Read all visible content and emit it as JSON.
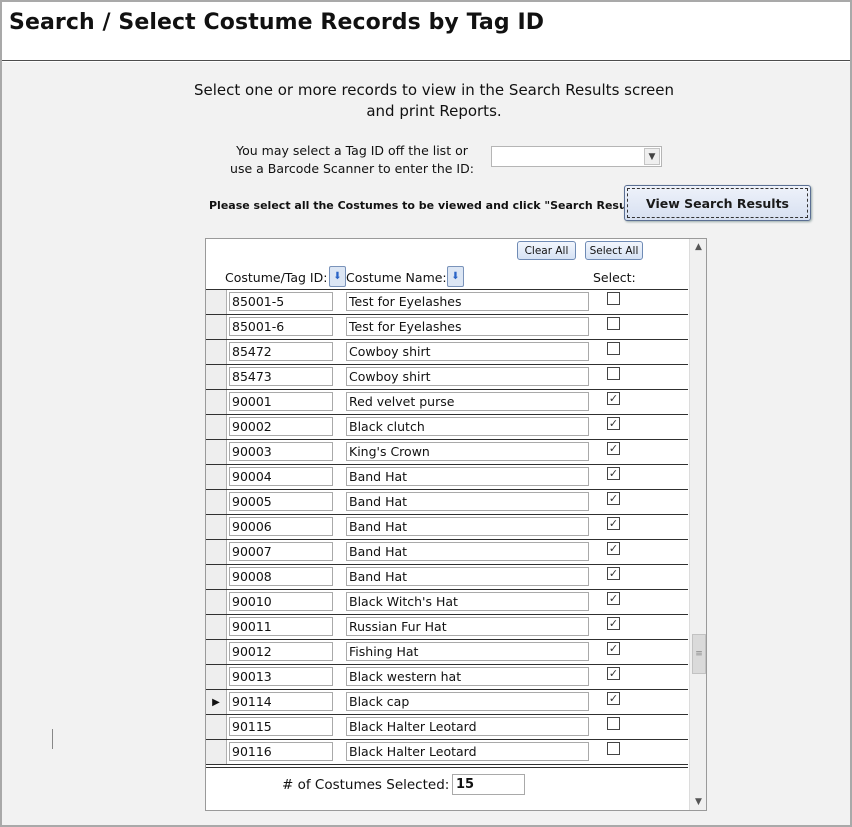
{
  "window": {
    "title": "Search / Select Costume Records by Tag ID"
  },
  "instructions": {
    "line1": "Select one or more records to view in the Search Results screen",
    "line2": "and print Reports."
  },
  "tag_select": {
    "label_line1": "You may select a Tag ID off the list or",
    "label_line2": "use a Barcode Scanner to enter the ID:",
    "value": ""
  },
  "prompt": "Please select all the Costumes to be viewed and click \"Search Results\"",
  "buttons": {
    "view_results": "View Search Results",
    "clear_all": "Clear All",
    "select_all": "Select All"
  },
  "table": {
    "columns": {
      "tag_id": "Costume/Tag ID:",
      "name": "Costume Name:",
      "select": "Select:"
    },
    "rows": [
      {
        "id": "85001-5",
        "name": "Test for Eyelashes",
        "selected": false,
        "current": false
      },
      {
        "id": "85001-6",
        "name": "Test for Eyelashes",
        "selected": false,
        "current": false
      },
      {
        "id": "85472",
        "name": "Cowboy shirt",
        "selected": false,
        "current": false
      },
      {
        "id": "85473",
        "name": "Cowboy shirt",
        "selected": false,
        "current": false
      },
      {
        "id": "90001",
        "name": "Red velvet purse",
        "selected": true,
        "current": false
      },
      {
        "id": "90002",
        "name": "Black clutch",
        "selected": true,
        "current": false
      },
      {
        "id": "90003",
        "name": "King's Crown",
        "selected": true,
        "current": false
      },
      {
        "id": "90004",
        "name": "Band Hat",
        "selected": true,
        "current": false
      },
      {
        "id": "90005",
        "name": "Band Hat",
        "selected": true,
        "current": false
      },
      {
        "id": "90006",
        "name": "Band Hat",
        "selected": true,
        "current": false
      },
      {
        "id": "90007",
        "name": "Band Hat",
        "selected": true,
        "current": false
      },
      {
        "id": "90008",
        "name": "Band Hat",
        "selected": true,
        "current": false
      },
      {
        "id": "90010",
        "name": "Black Witch's Hat",
        "selected": true,
        "current": false
      },
      {
        "id": "90011",
        "name": "Russian Fur Hat",
        "selected": true,
        "current": false
      },
      {
        "id": "90012",
        "name": "Fishing Hat",
        "selected": true,
        "current": false
      },
      {
        "id": "90013",
        "name": "Black western hat",
        "selected": true,
        "current": false
      },
      {
        "id": "90114",
        "name": "Black cap",
        "selected": true,
        "current": true
      },
      {
        "id": "90115",
        "name": "Black Halter Leotard",
        "selected": false,
        "current": false
      },
      {
        "id": "90116",
        "name": "Black Halter Leotard",
        "selected": false,
        "current": false
      }
    ]
  },
  "footer": {
    "count_label": "# of Costumes Selected:",
    "count_value": "15"
  },
  "icons": {
    "combo_dropdown": "chevron-down-icon",
    "sort": "sort-arrow-icon",
    "record_pointer": "record-pointer-icon",
    "scroll_up": "scroll-up-icon",
    "scroll_down": "scroll-down-icon"
  }
}
